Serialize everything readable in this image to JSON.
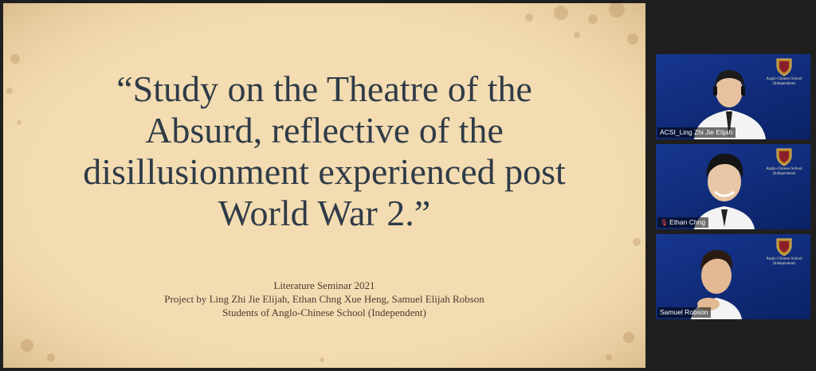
{
  "slide": {
    "title_lines": [
      "“Study on the Theatre of the",
      "Absurd, reflective of the",
      "disillusionment experienced post",
      "World War 2.”"
    ],
    "subtitle_lines": [
      "Literature Seminar 2021",
      "Project by Ling Zhi Jie Elijah, Ethan Chng Xue Heng, Samuel Elijah Robson",
      "Students of Anglo-Chinese School (Independent)"
    ],
    "colors": {
      "background": "#f3dcb1",
      "title": "#2f3b47"
    }
  },
  "participants": [
    {
      "name": "ACSI_Ling Zhi Jie Elijah",
      "muted": false,
      "school": "Anglo-Chinese School (Independent)"
    },
    {
      "name": "Ethan Chng",
      "muted": true,
      "school": "Anglo-Chinese School (Independent)"
    },
    {
      "name": "Samuel Robson",
      "muted": false,
      "school": "Anglo-Chinese School (Independent)"
    }
  ],
  "icons": {
    "muted_indicator": "mic-muted-icon",
    "crest": "school-crest-icon"
  }
}
